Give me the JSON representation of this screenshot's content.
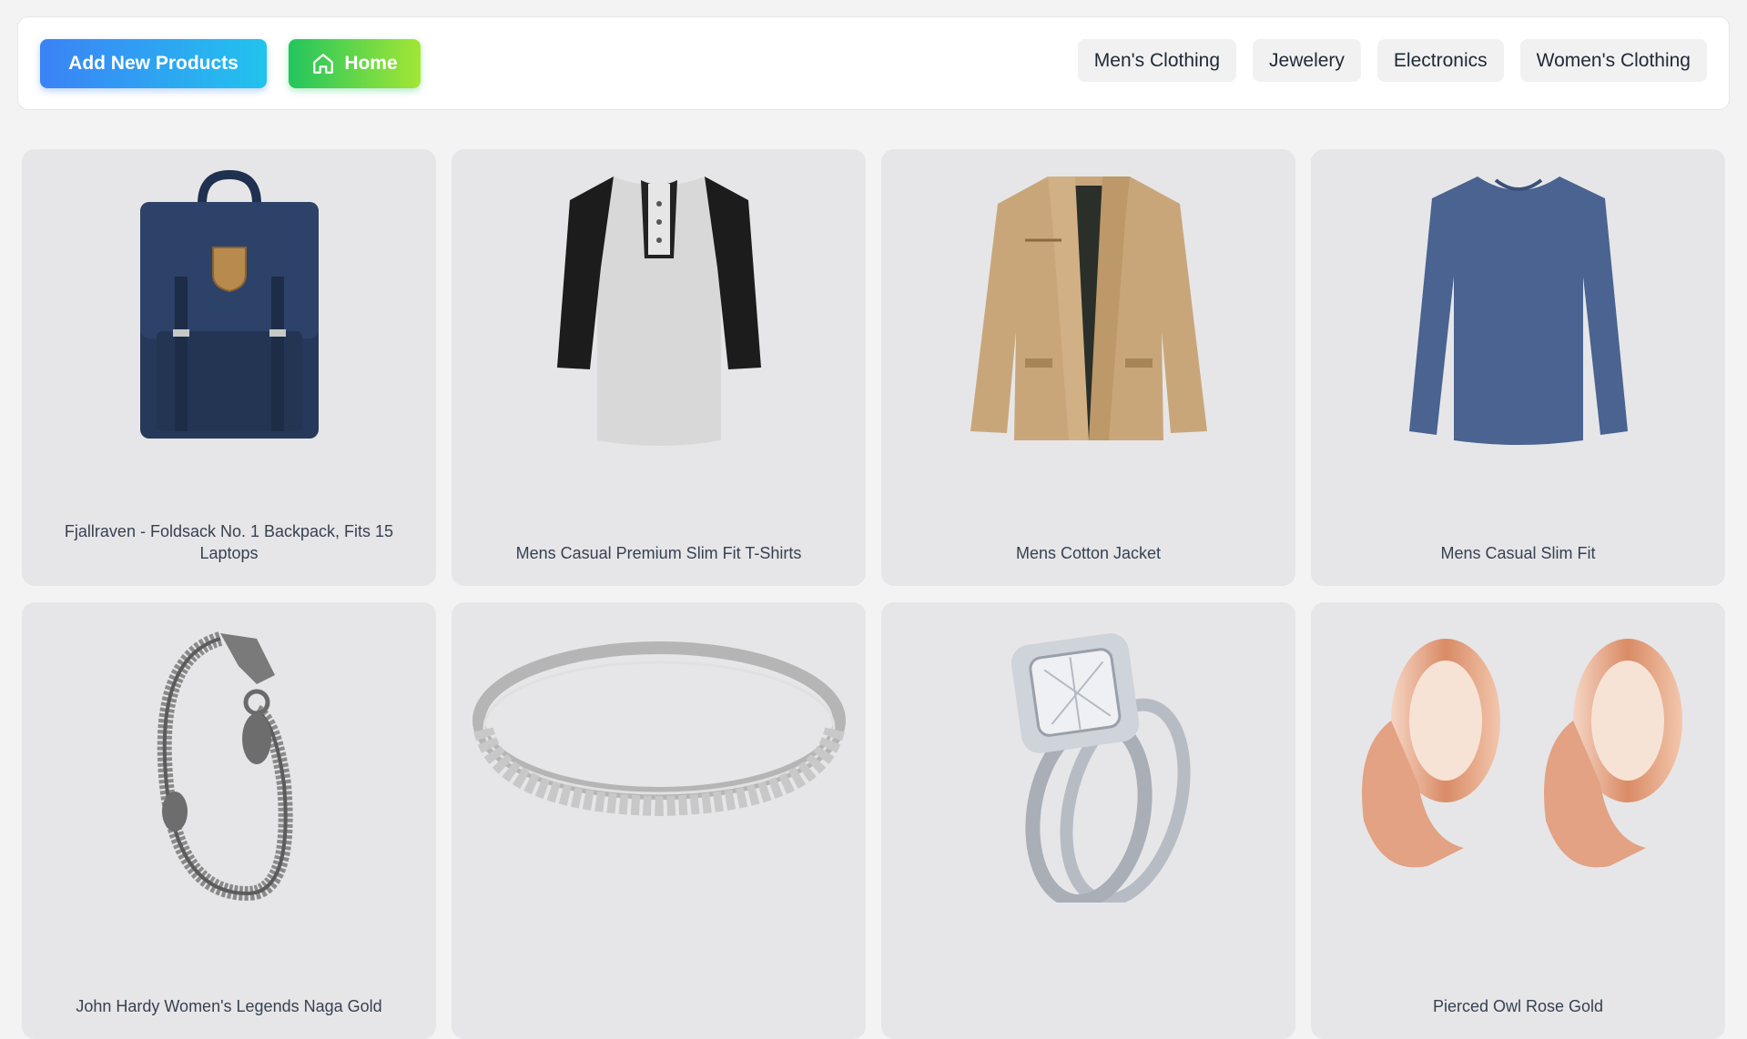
{
  "header": {
    "add_label": "Add New Products",
    "home_label": "Home",
    "categories": [
      "Men's Clothing",
      "Jewelery",
      "Electronics",
      "Women's Clothing"
    ]
  },
  "products": [
    {
      "title": "Fjallraven - Foldsack No. 1 Backpack, Fits 15 Laptops",
      "image": "backpack"
    },
    {
      "title": "Mens Casual Premium Slim Fit T-Shirts",
      "image": "tshirt"
    },
    {
      "title": "Mens Cotton Jacket",
      "image": "jacket"
    },
    {
      "title": "Mens Casual Slim Fit",
      "image": "longsleeve"
    },
    {
      "title": "John Hardy Women's Legends Naga Gold",
      "image": "bracelet"
    },
    {
      "title": "",
      "image": "band-ring"
    },
    {
      "title": "",
      "image": "diamond-ring"
    },
    {
      "title": "Pierced Owl Rose Gold",
      "image": "plugs"
    }
  ],
  "colors": {
    "add_gradient": [
      "#3b82f6",
      "#22c3ee"
    ],
    "home_gradient": [
      "#22c55e",
      "#a3e635"
    ],
    "card_bg": "#e6e6e8"
  }
}
